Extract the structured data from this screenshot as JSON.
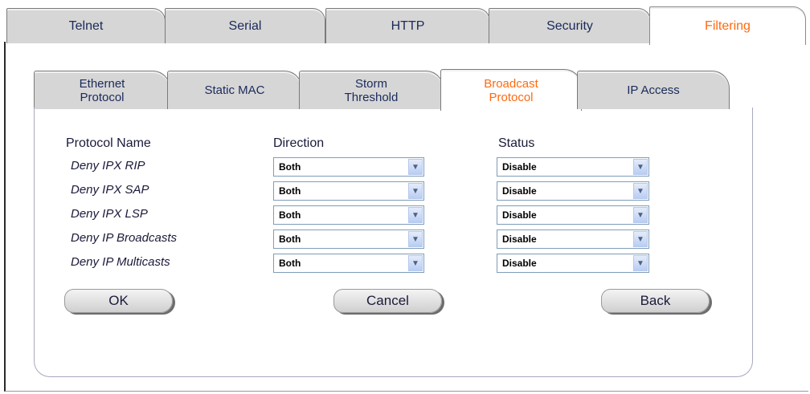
{
  "top_tabs": [
    {
      "label": "Telnet",
      "active": false
    },
    {
      "label": "Serial",
      "active": false
    },
    {
      "label": "HTTP",
      "active": false
    },
    {
      "label": "Security",
      "active": false
    },
    {
      "label": "Filtering",
      "active": true
    }
  ],
  "sub_tabs": [
    {
      "label": "Ethernet Protocol",
      "active": false
    },
    {
      "label": "Static MAC",
      "active": false
    },
    {
      "label": "Storm Threshold",
      "active": false
    },
    {
      "label": "Broadcast Protocol",
      "active": true
    },
    {
      "label": "IP Access",
      "active": false
    }
  ],
  "table": {
    "headers": {
      "name": "Protocol Name",
      "direction": "Direction",
      "status": "Status"
    },
    "rows": [
      {
        "name": "Deny IPX RIP",
        "direction": "Both",
        "status": "Disable"
      },
      {
        "name": "Deny IPX SAP",
        "direction": "Both",
        "status": "Disable"
      },
      {
        "name": "Deny IPX LSP",
        "direction": "Both",
        "status": "Disable"
      },
      {
        "name": "Deny IP Broadcasts",
        "direction": "Both",
        "status": "Disable"
      },
      {
        "name": "Deny IP Multicasts",
        "direction": "Both",
        "status": "Disable"
      }
    ]
  },
  "buttons": {
    "ok": "OK",
    "cancel": "Cancel",
    "back": "Back"
  },
  "colors": {
    "active_tab_text": "#ff6a10",
    "tab_bg": "#d6d6d6",
    "text": "#1a1a3a"
  }
}
